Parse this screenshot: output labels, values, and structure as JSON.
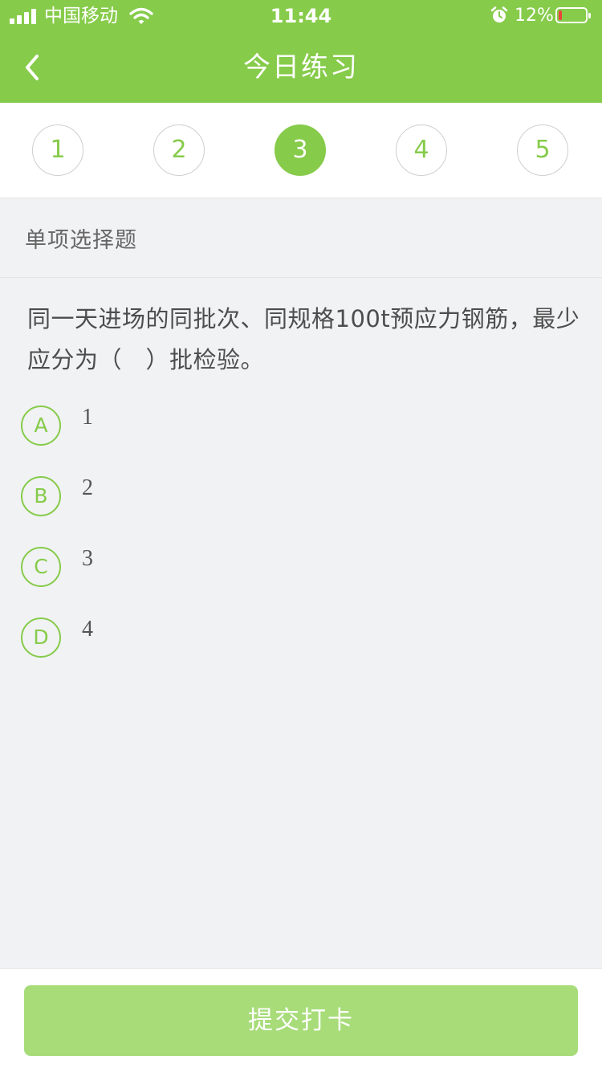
{
  "status_bar": {
    "carrier": "中国移动",
    "time": "11:44",
    "battery_percent": "12%",
    "battery_level": 0.12,
    "icons": [
      "signal-icon",
      "wifi-icon",
      "alarm-icon",
      "battery-icon"
    ]
  },
  "nav": {
    "title": "今日练习",
    "back_icon": "chevron-left-icon"
  },
  "steps": {
    "items": [
      "1",
      "2",
      "3",
      "4",
      "5"
    ],
    "active_index": 2
  },
  "question": {
    "type_label": "单项选择题",
    "stem": "同一天进场的同批次、同规格100t预应力钢筋，最少应分为（　）批检验。",
    "options": [
      {
        "letter": "A",
        "text": "1"
      },
      {
        "letter": "B",
        "text": "2"
      },
      {
        "letter": "C",
        "text": "3"
      },
      {
        "letter": "D",
        "text": "4"
      }
    ]
  },
  "footer": {
    "submit_label": "提交打卡"
  },
  "colors": {
    "brand_green": "#86cb4a",
    "button_green_disabled": "#a7dc79",
    "background": "#f1f2f4",
    "text_primary": "#4d4d4d",
    "battery_low": "#e8453c"
  }
}
